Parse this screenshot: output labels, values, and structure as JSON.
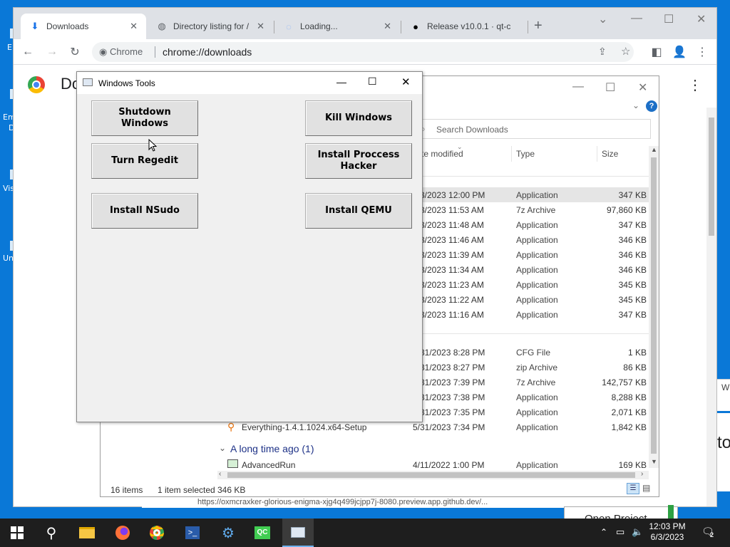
{
  "desktop": {
    "labels": [
      "E",
      "Em",
      "D",
      "Vis",
      "Un"
    ]
  },
  "chrome": {
    "tabs": [
      {
        "title": "Downloads",
        "icon": "download-icon"
      },
      {
        "title": "Directory listing for /",
        "icon": "globe-icon"
      },
      {
        "title": "Loading...",
        "icon": "spinner-icon"
      },
      {
        "title": "Release v10.0.1 · qt-c",
        "icon": "github-icon"
      }
    ],
    "new_tab": "+",
    "omnibox": {
      "chip": "Chrome",
      "url": "chrome://downloads"
    },
    "page_title": "Do",
    "status_url": "https://oxmcraxker-glorious-enigma-xjg4q499jcjpp7j-8080.preview.app.github.dev/...",
    "overflow_right": [
      "W",
      "to"
    ],
    "open_project": "Open Project"
  },
  "explorer": {
    "search_placeholder": "Search Downloads",
    "columns": {
      "date": "te modified",
      "type": "Type",
      "size": "Size"
    },
    "rows_today": [
      {
        "date": "3/2023 12:00 PM",
        "type": "Application",
        "size": "347 KB",
        "selected": true
      },
      {
        "date": "3/2023 11:53 AM",
        "type": "7z Archive",
        "size": "97,860 KB"
      },
      {
        "date": "3/2023 11:48 AM",
        "type": "Application",
        "size": "347 KB"
      },
      {
        "date": "3/2023 11:46 AM",
        "type": "Application",
        "size": "346 KB"
      },
      {
        "date": "3/2023 11:39 AM",
        "type": "Application",
        "size": "346 KB"
      },
      {
        "date": "3/2023 11:34 AM",
        "type": "Application",
        "size": "346 KB"
      },
      {
        "date": "3/2023 11:23 AM",
        "type": "Application",
        "size": "345 KB"
      },
      {
        "date": "3/2023 11:22 AM",
        "type": "Application",
        "size": "345 KB"
      },
      {
        "date": "3/2023 11:16 AM",
        "type": "Application",
        "size": "347 KB"
      }
    ],
    "rows_earlier": [
      {
        "date": "31/2023 8:28 PM",
        "type": "CFG File",
        "size": "1 KB"
      },
      {
        "date": "31/2023 8:27 PM",
        "type": "zip Archive",
        "size": "86 KB"
      },
      {
        "date": "31/2023 7:39 PM",
        "type": "7z Archive",
        "size": "142,757 KB"
      },
      {
        "date": "31/2023 7:38 PM",
        "type": "Application",
        "size": "8,288 KB"
      },
      {
        "date": "31/2023 7:35 PM",
        "type": "Application",
        "size": "2,071 KB"
      }
    ],
    "everything_row": {
      "name": "Everything-1.4.1.1024.x64-Setup",
      "date": "5/31/2023 7:34 PM",
      "type": "Application",
      "size": "1,842 KB"
    },
    "group_long_ago": "A long time ago (1)",
    "advanced_row": {
      "name": "AdvancedRun",
      "date": "4/11/2022 1:00 PM",
      "type": "Application",
      "size": "169 KB"
    },
    "status": {
      "items": "16 items",
      "selected": "1 item selected",
      "size": "346 KB"
    }
  },
  "tools": {
    "title": "Windows Tools",
    "buttons": {
      "shutdown": "Shutdown Windows",
      "kill": "Kill Windows",
      "regedit": "Turn Regedit",
      "process_hacker": "Install Proccess Hacker",
      "nsudo": "Install NSudo",
      "qemu": "Install QEMU"
    }
  },
  "taskbar": {
    "time": "12:03 PM",
    "date": "6/3/2023",
    "notifications": "2"
  }
}
